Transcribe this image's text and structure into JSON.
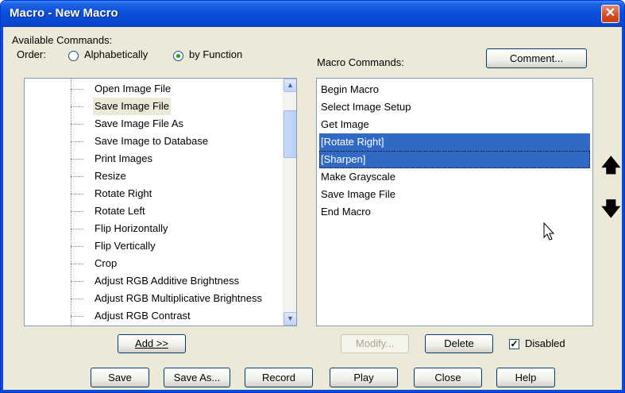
{
  "window": {
    "title": "Macro - New Macro",
    "close_glyph": "✕"
  },
  "available": {
    "label": "Available Commands:",
    "order_label": "Order:",
    "order_options": [
      {
        "label": "Alphabetically",
        "checked": false
      },
      {
        "label": "by Function",
        "checked": true
      }
    ],
    "items": [
      "Open Image File",
      "Save Image File",
      "Save Image File As",
      "Save Image to Database",
      "Print Images",
      "Resize",
      "Rotate Right",
      "Rotate Left",
      "Flip Horizontally",
      "Flip Vertically",
      "Crop",
      "Adjust RGB Additive Brightness",
      "Adjust RGB Multiplicative Brightness",
      "Adjust RGB Contrast"
    ],
    "selected_item": "Save Image File"
  },
  "macro": {
    "label": "Macro Commands:",
    "comment_button": "Comment...",
    "items": [
      {
        "text": "Begin Macro",
        "selected": false
      },
      {
        "text": "Select Image Setup",
        "selected": false
      },
      {
        "text": "Get Image",
        "selected": false
      },
      {
        "text": "[Rotate Right]",
        "selected": true
      },
      {
        "text": "[Sharpen]",
        "selected": true
      },
      {
        "text": "Make Grayscale",
        "selected": false
      },
      {
        "text": "Save Image File",
        "selected": false
      },
      {
        "text": "End Macro",
        "selected": false
      }
    ]
  },
  "controls": {
    "add_button": "Add >>",
    "modify_button": "Modify...",
    "delete_button": "Delete",
    "disabled_checkbox": {
      "label": "Disabled",
      "checked": true
    }
  },
  "footer": {
    "save": "Save",
    "save_as": "Save As...",
    "record": "Record",
    "play": "Play",
    "close": "Close",
    "help": "Help"
  },
  "icons": {
    "up": "🡅",
    "down": "🡇",
    "scroll_up": "▲",
    "scroll_down": "▼"
  },
  "colors": {
    "titlebar": "#0a4ed8",
    "selection": "#316ac5",
    "close_button": "#d64b22"
  }
}
